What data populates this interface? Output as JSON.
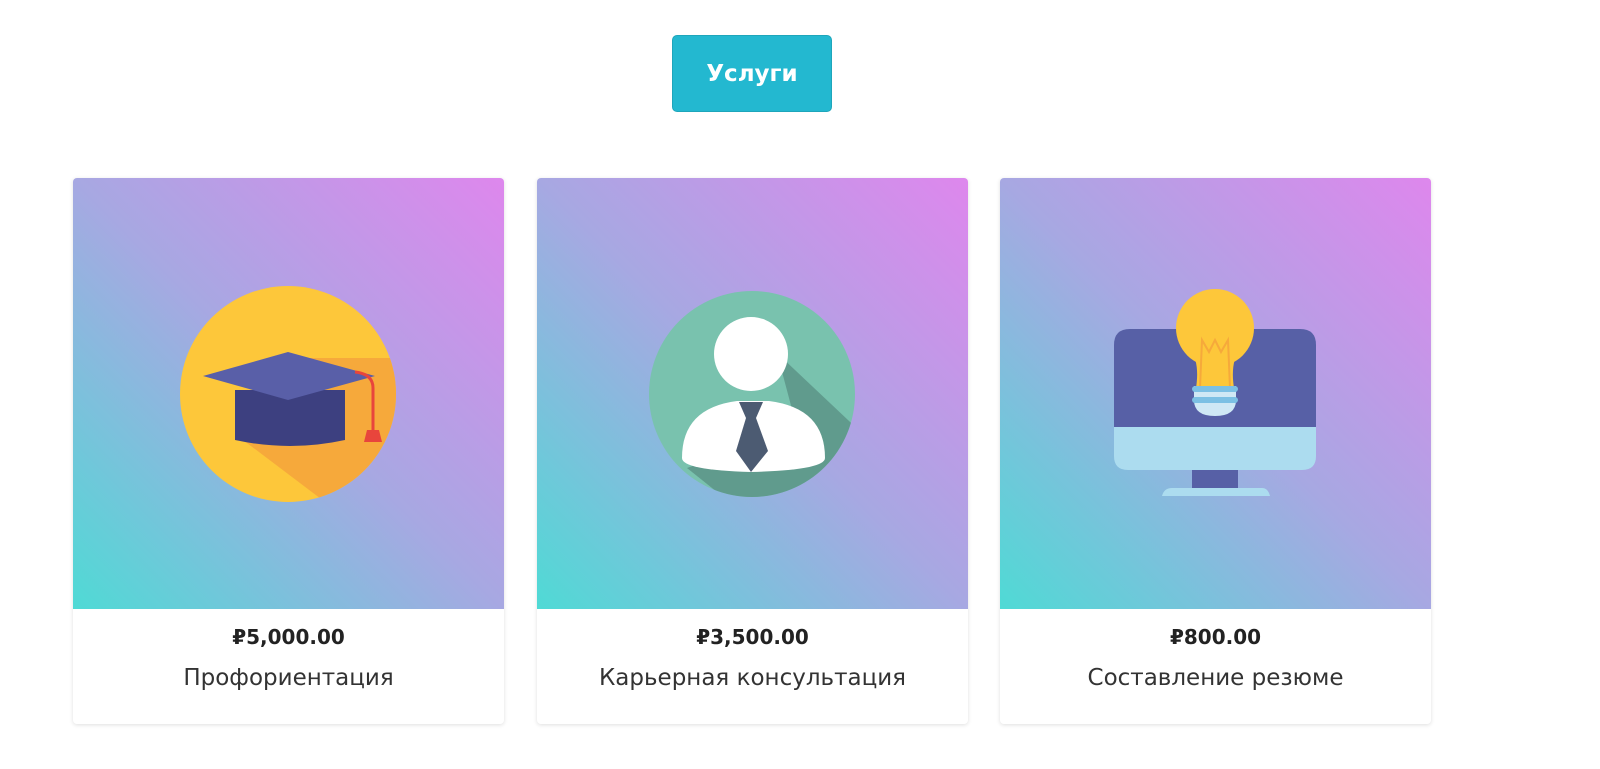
{
  "header": {
    "services_label": "Услуги"
  },
  "services": [
    {
      "price": "₽5,000.00",
      "title": "Профориентация",
      "icon": "graduation-cap-icon"
    },
    {
      "price": "₽3,500.00",
      "title": "Карьерная консультация",
      "icon": "businessman-icon"
    },
    {
      "price": "₽800.00",
      "title": "Составление резюме",
      "icon": "monitor-lightbulb-icon"
    }
  ],
  "colors": {
    "button": "#23b8d0",
    "gradient_start": "#4fdad5",
    "gradient_end": "#de87ed"
  }
}
